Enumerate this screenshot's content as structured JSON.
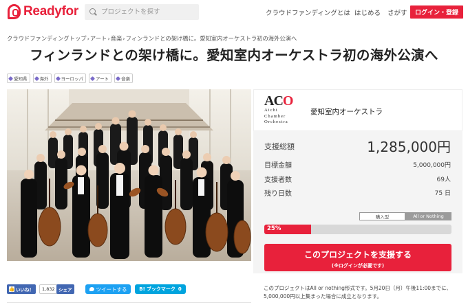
{
  "header": {
    "logo_text": "Readyfor",
    "search_placeholder": "プロジェクトを探す",
    "nav_about": "クラウドファンディングとは",
    "nav_start": "はじめる",
    "nav_find": "さがす",
    "login_label": "ログイン・登録"
  },
  "breadcrumb": {
    "items": [
      "クラウドファンディングトップ",
      "アート",
      "音楽",
      "フィンランドとの架け橋に。愛知室内オーケストラ初の海外公演へ"
    ],
    "separator": "›"
  },
  "page_title": "フィンランドとの架け橋に。愛知室内オーケストラ初の海外公演へ",
  "tags": [
    "愛知県",
    "海外",
    "ヨーロッパ",
    "アート",
    "音楽"
  ],
  "organization": {
    "logo_big_a": "A",
    "logo_big_c": "C",
    "logo_big_o": "O",
    "logo_line1": "Aichi",
    "logo_line2": "Chamber",
    "logo_line3": "Orchestra",
    "name": "愛知室内オーケストラ"
  },
  "stats": {
    "total_label": "支援総額",
    "total_value": "1,285,000円",
    "goal_label": "目標金額",
    "goal_value": "5,000,000円",
    "backers_label": "支援者数",
    "backers_value": "69人",
    "days_label": "残り日数",
    "days_value": "75 日"
  },
  "funding_type": {
    "option_keep_it": "購入型",
    "option_all_or_nothing": "All or Nothing",
    "selected": "All or Nothing"
  },
  "progress": {
    "percent_label": "25%",
    "fraction": 0.25
  },
  "support_button": {
    "label": "このプロジェクトを支援する",
    "sub_label": "(※ログインが必要です)"
  },
  "social": {
    "fb_like_label": "いいね！",
    "fb_like_count": "1,832",
    "fb_share_label": "シェア",
    "tweet_label": "ツイートする",
    "hatena_label": "ブックマーク",
    "hatena_count": "0",
    "hatena_mark": "B!"
  },
  "note": "このプロジェクトはAll or nothing形式です。5月20日（月）午後11:00までに、5,000,000円以上集まった場合に成立となります。",
  "colors": {
    "brand": "#e8213b",
    "facebook": "#4267b2",
    "twitter": "#1da1f2",
    "hatena": "#00a4de"
  }
}
